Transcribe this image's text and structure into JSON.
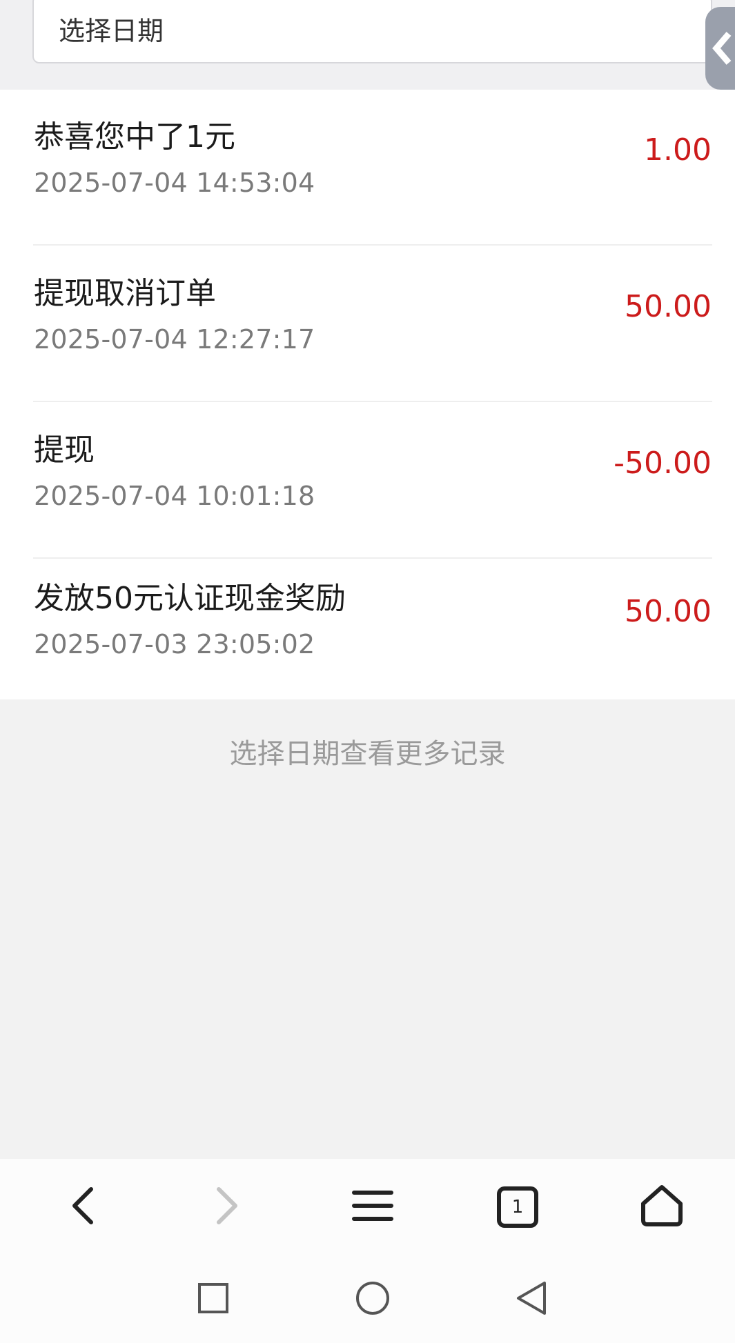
{
  "date_picker": {
    "placeholder": "选择日期"
  },
  "records": [
    {
      "title": "恭喜您中了1元",
      "time": "2025-07-04 14:53:04",
      "amount": "1.00"
    },
    {
      "title": "提现取消订单",
      "time": "2025-07-04 12:27:17",
      "amount": "50.00"
    },
    {
      "title": "提现",
      "time": "2025-07-04 10:01:18",
      "amount": "-50.00"
    },
    {
      "title": "发放50元认证现金奖励",
      "time": "2025-07-03 23:05:02",
      "amount": "50.00"
    }
  ],
  "more_hint": "选择日期查看更多记录",
  "browser_toolbar": {
    "tab_count": "1",
    "icons": [
      "back-icon",
      "forward-icon",
      "menu-icon",
      "tabs-icon",
      "home-icon"
    ]
  },
  "system_nav": {
    "icons": [
      "recents-icon",
      "home-circle-icon",
      "back-triangle-icon"
    ]
  },
  "colors": {
    "amount": "#cc1b1b",
    "page_background": "#f2f2f2"
  }
}
